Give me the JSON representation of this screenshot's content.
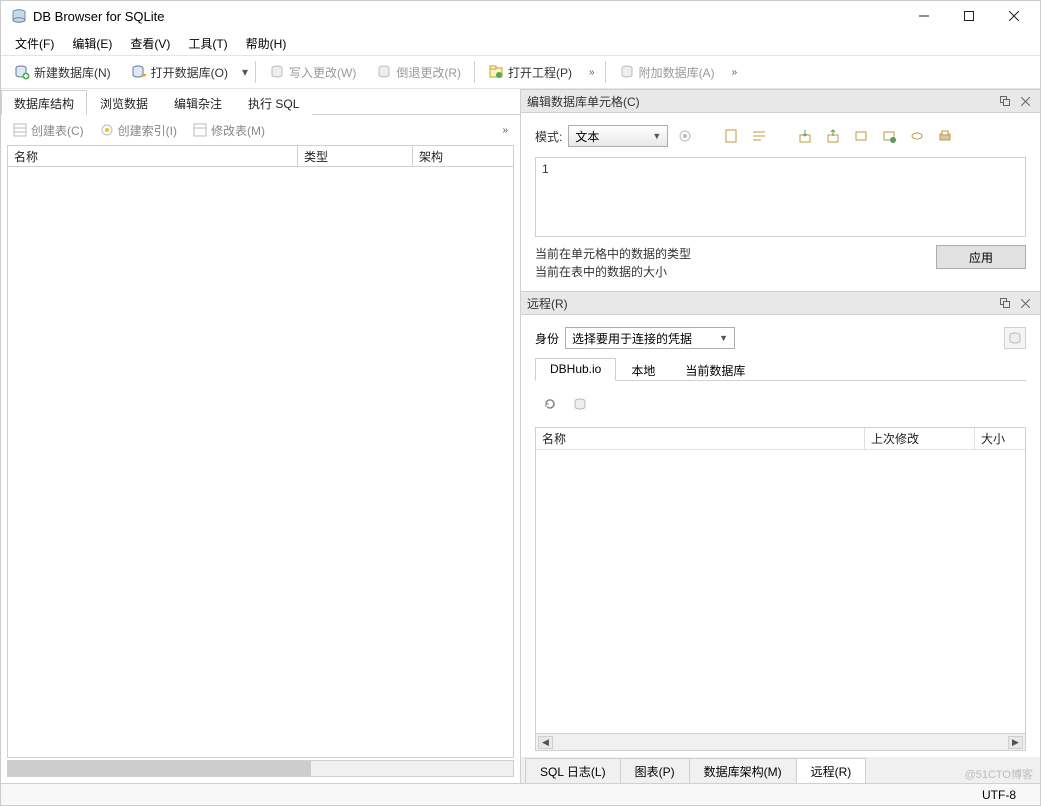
{
  "window": {
    "title": "DB Browser for SQLite"
  },
  "menu": {
    "file": "文件(F)",
    "edit": "编辑(E)",
    "view": "查看(V)",
    "tools": "工具(T)",
    "help": "帮助(H)"
  },
  "toolbar": {
    "new_db": "新建数据库(N)",
    "open_db": "打开数据库(O)",
    "write_changes": "写入更改(W)",
    "revert_changes": "倒退更改(R)",
    "open_project": "打开工程(P)",
    "attach_db": "附加数据库(A)"
  },
  "left_tabs": {
    "structure": "数据库结构",
    "browse": "浏览数据",
    "pragma": "编辑杂注",
    "sql": "执行 SQL"
  },
  "struct_toolbar": {
    "create_table": "创建表(C)",
    "create_index": "创建索引(I)",
    "modify_table": "修改表(M)"
  },
  "struct_cols": {
    "name": "名称",
    "type": "类型",
    "schema": "架构"
  },
  "editcell": {
    "title": "编辑数据库单元格(C)",
    "mode_label": "模式:",
    "mode_value": "文本",
    "content": "1",
    "info1": "当前在单元格中的数据的类型",
    "info2": "当前在表中的数据的大小",
    "apply": "应用"
  },
  "remote": {
    "title": "远程(R)",
    "identity_label": "身份",
    "identity_value": "选择要用于连接的凭据",
    "tabs": {
      "dbhub": "DBHub.io",
      "local": "本地",
      "current": "当前数据库"
    },
    "cols": {
      "name": "名称",
      "modified": "上次修改",
      "size": "大小"
    }
  },
  "bottom_tabs": {
    "sql_log": "SQL 日志(L)",
    "chart": "图表(P)",
    "schema": "数据库架构(M)",
    "remote": "远程(R)"
  },
  "status": {
    "encoding": "UTF-8"
  },
  "watermark": "@51CTO博客"
}
